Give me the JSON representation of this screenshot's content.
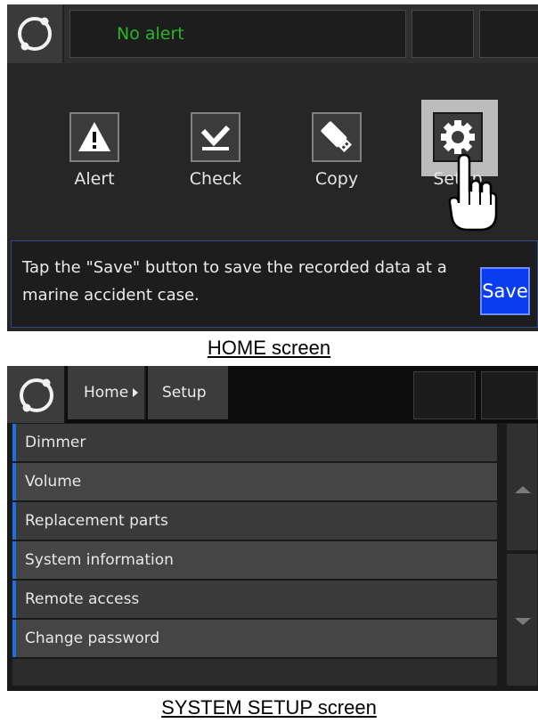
{
  "home": {
    "alert_status": "No alert",
    "apps": [
      {
        "label": "Alert",
        "icon": "warning-triangle-icon"
      },
      {
        "label": "Check",
        "icon": "checkmark-icon"
      },
      {
        "label": "Copy",
        "icon": "usb-drive-icon"
      },
      {
        "label": "Setup",
        "icon": "gear-icon"
      }
    ],
    "message": "Tap the \"Save\" button to save the recorded data at a marine accident case.",
    "save_label": "Save",
    "caption": "HOME screen"
  },
  "setup": {
    "breadcrumb": {
      "home": "Home",
      "current": "Setup"
    },
    "menu_items": [
      "Dimmer",
      "Volume",
      "Replacement parts",
      "System information",
      "Remote access",
      "Change password"
    ],
    "caption": "SYSTEM SETUP screen"
  },
  "colors": {
    "alert_green": "#28b628",
    "save_blue": "#0b3df0",
    "menu_accent": "#1f6fe2"
  }
}
